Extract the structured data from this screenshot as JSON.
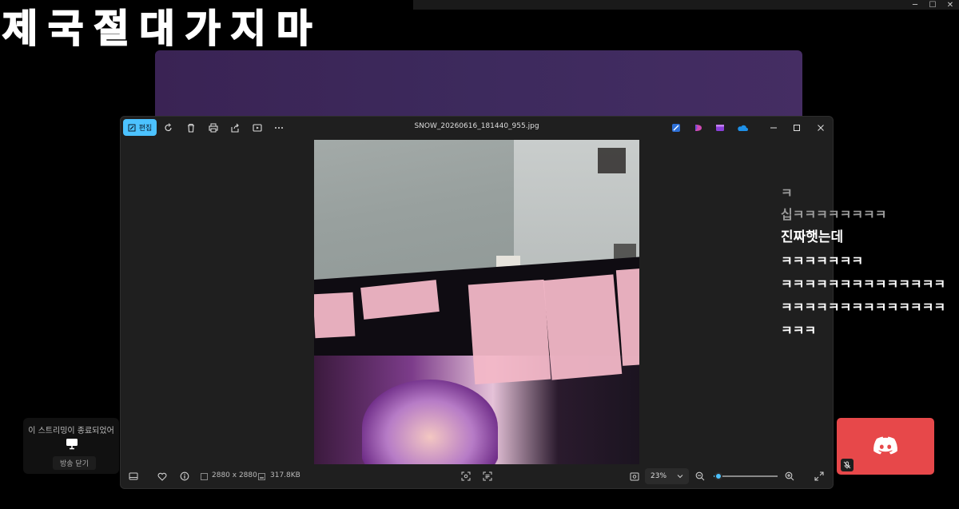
{
  "background_title": "제국절대가지마",
  "viewer": {
    "edit_label": "편집",
    "filename": "SNOW_20260616_181440_955.jpg",
    "dimensions": "2880 x 2880",
    "file_size": "317.8KB",
    "zoom": "23%",
    "zoom_level": 0.07,
    "accent": "#4cc2ff",
    "icons": {
      "rotate": "rotate-icon",
      "delete": "trash-icon",
      "print": "print-icon",
      "share": "share-icon",
      "slideshow": "slideshow-icon",
      "more": "more-icon",
      "filmstrip": "filmstrip-icon",
      "favorite": "heart-icon",
      "info": "info-icon"
    }
  },
  "chat": {
    "lines": [
      "ㅋ",
      "십ㅋㅋㅋㅋㅋㅋㅋㅋ",
      "진짜햇는데",
      "ㅋㅋㅋㅋㅋㅋㅋ",
      "ㅋㅋㅋㅋㅋㅋㅋㅋㅋㅋㅋㅋㅋㅋ",
      "ㅋㅋㅋㅋㅋㅋㅋㅋㅋㅋㅋㅋㅋㅋ",
      "ㅋㅋㅋ"
    ]
  },
  "stream_ended": {
    "message": "이 스트리밍이 종료되었어",
    "close_label": "방송 닫기"
  },
  "discord": {
    "color": "#e7484a"
  }
}
